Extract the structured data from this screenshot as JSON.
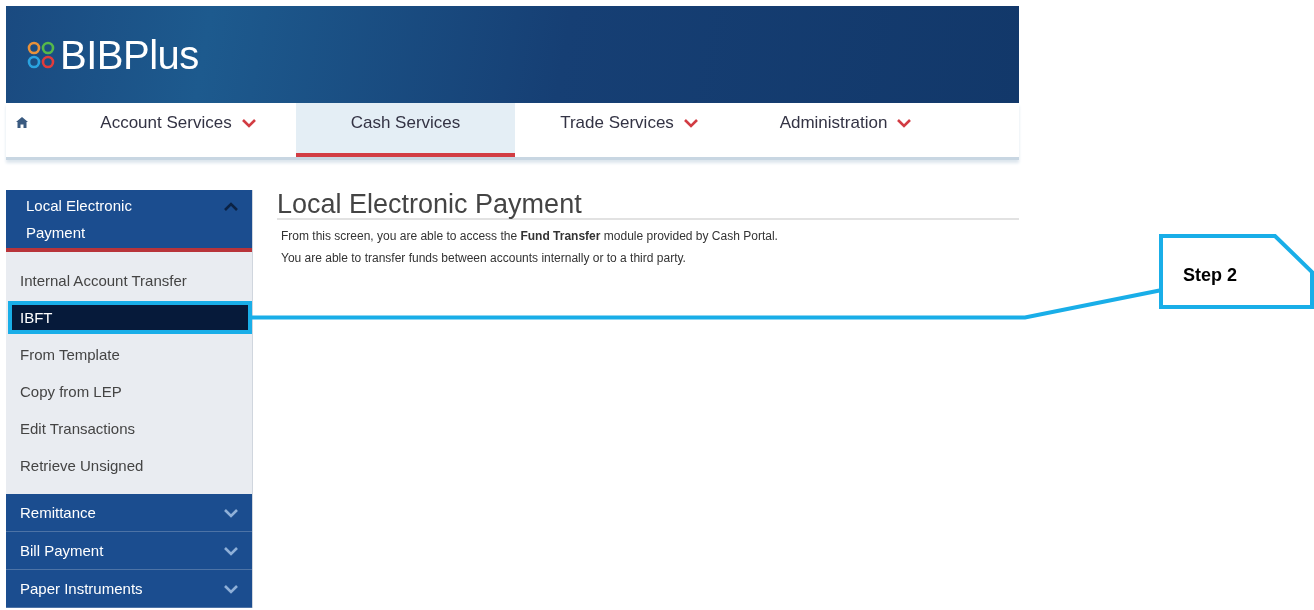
{
  "header": {
    "logo": "BIBPlus"
  },
  "nav": {
    "tabs": [
      {
        "label": "Account Services",
        "selected": false,
        "dropdown": true
      },
      {
        "label": "Cash Services",
        "selected": true,
        "dropdown": false
      },
      {
        "label": "Trade Services",
        "selected": false,
        "dropdown": true
      },
      {
        "label": "Administration",
        "selected": false,
        "dropdown": true
      }
    ]
  },
  "sidebar": {
    "sections": [
      {
        "label": "Local Electronic Payment",
        "expanded": true,
        "items": [
          {
            "label": "Internal Account Transfer",
            "selected": false
          },
          {
            "label": "IBFT",
            "selected": true
          },
          {
            "label": "From Template",
            "selected": false
          },
          {
            "label": "Copy from LEP",
            "selected": false
          },
          {
            "label": "Edit Transactions",
            "selected": false
          },
          {
            "label": "Retrieve Unsigned",
            "selected": false
          }
        ]
      },
      {
        "label": "Remittance",
        "expanded": false
      },
      {
        "label": "Bill Payment",
        "expanded": false
      },
      {
        "label": "Paper Instruments",
        "expanded": false
      }
    ]
  },
  "content": {
    "title": "Local Electronic Payment",
    "paragraphs": [
      "From this screen, you are able to access the **Fund Transfer** module provided by Cash Portal.",
      "You are able to transfer funds between accounts internally or to a third party."
    ]
  },
  "callout": {
    "label": "Step 2"
  }
}
